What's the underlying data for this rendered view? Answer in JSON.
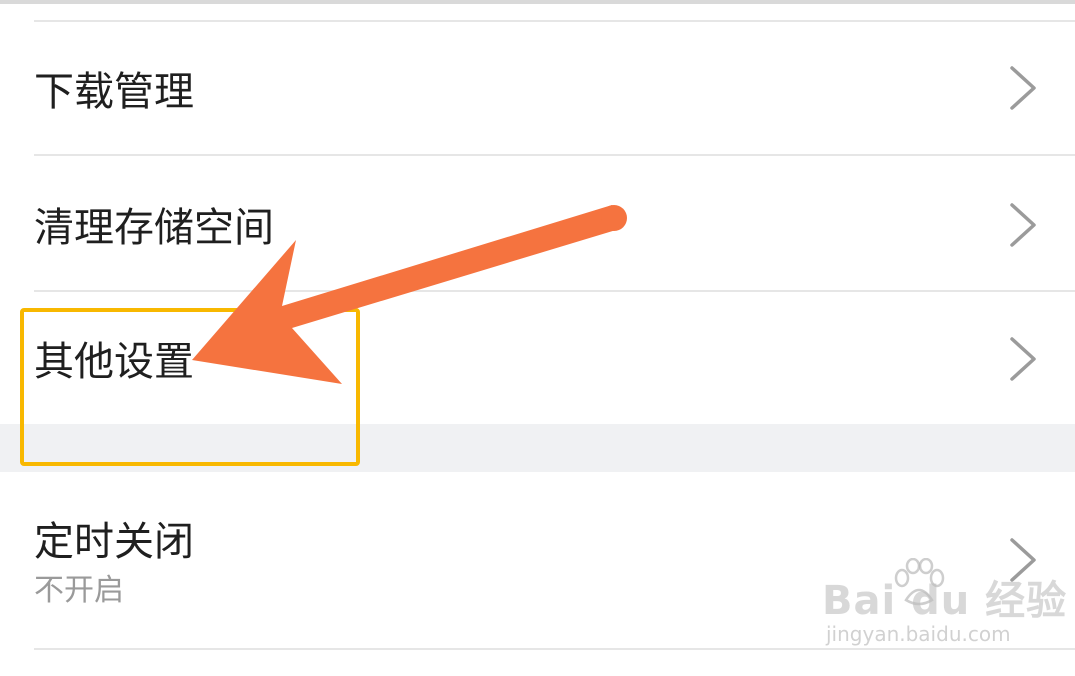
{
  "settings_list": {
    "items": [
      {
        "label": "下载管理"
      },
      {
        "label": "清理存储空间"
      },
      {
        "label": "其他设置"
      },
      {
        "label": "定时关闭",
        "sublabel": "不开启"
      }
    ]
  },
  "annotation": {
    "highlight_color": "#f8b800",
    "arrow_color": "#f5733f"
  },
  "watermark": {
    "logo_text": "Bai du 经验",
    "url_text": "jingyan.baidu.com"
  },
  "icons": {
    "row_chevron": "chevron-right-icon",
    "watermark_paw": "baidu-paw-icon"
  }
}
